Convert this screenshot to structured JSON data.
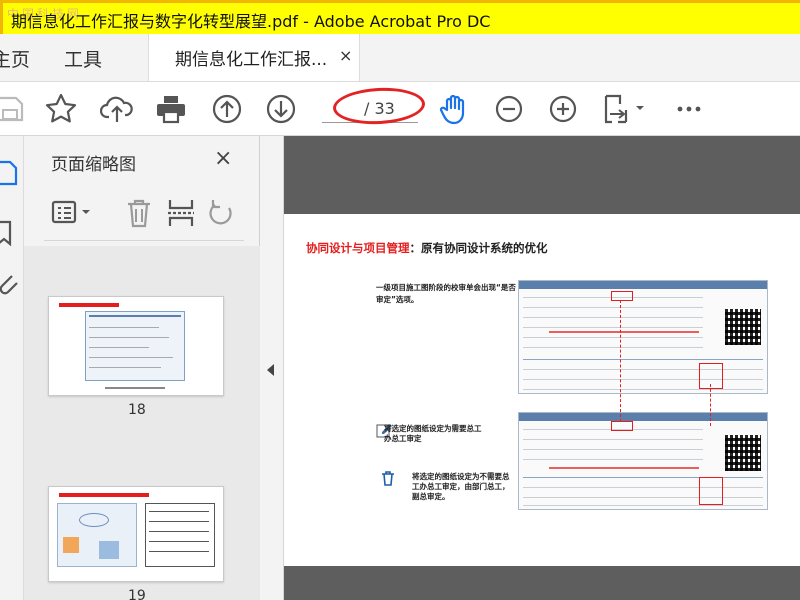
{
  "window": {
    "title": "期信息化工作汇报与数字化转型展望.pdf - Adobe Acrobat Pro DC",
    "watermark": "中国科技网"
  },
  "tabs": {
    "home_label": "主页",
    "tools_label": "工具",
    "document_label": "期信息化工作汇报...",
    "close_label": "×"
  },
  "toolbar": {
    "page_total": "/ 33",
    "icons": [
      "save-icon",
      "star-icon",
      "upload-cloud-icon",
      "print-icon",
      "page-up-icon",
      "page-down-icon",
      "hand-tool-icon",
      "zoom-out-icon",
      "zoom-in-icon",
      "fit-page-icon",
      "more-icon"
    ]
  },
  "panel": {
    "title": "页面缩略图",
    "close_label": "×",
    "thumbnails": [
      {
        "number": "18"
      },
      {
        "number": "19"
      }
    ]
  },
  "page": {
    "heading_red": "协同设计与项目管理",
    "heading_black": "：原有协同设计系统的优化",
    "note1": "一级项目施工图阶段的校审单会出现“是否审定”选项。",
    "note2": "将选定的图纸设定为需要总工办总工审定",
    "note3": "将选定的图纸设定为不需要总工办总工审定，由部门总工，副总审定。"
  },
  "colors": {
    "title_bar": "#ffff00",
    "accent_blue": "#1a73e8",
    "annotation_red": "#e52222"
  }
}
